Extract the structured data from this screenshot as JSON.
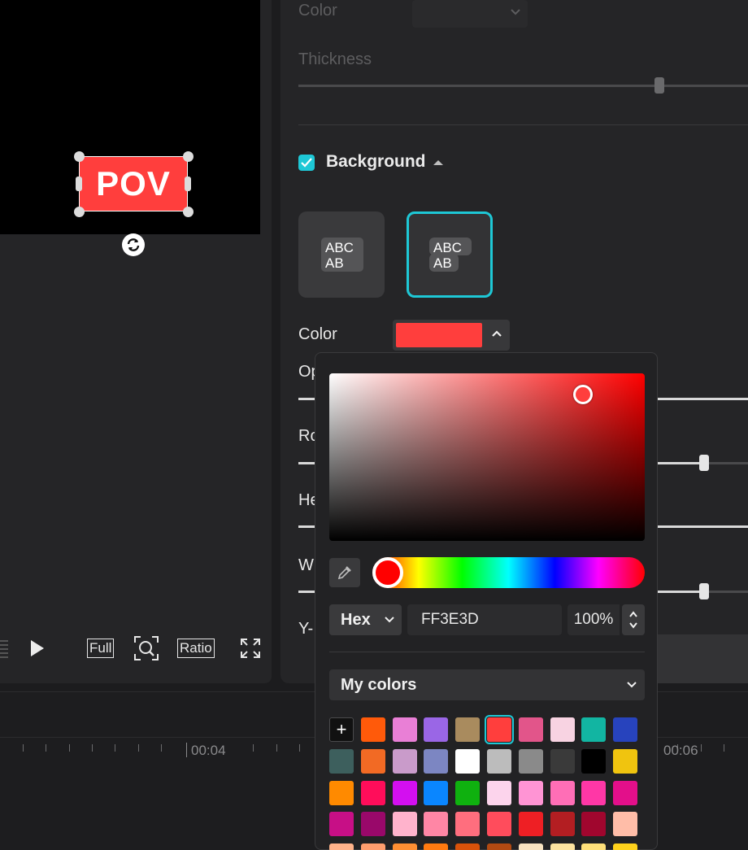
{
  "player": {
    "text_overlay": "POV",
    "buttons": {
      "full": "Full",
      "ratio": "Ratio"
    }
  },
  "props": {
    "border_color_label": "Color",
    "thickness_label": "Thickness",
    "background_label": "Background",
    "background_checked": true,
    "style_option_text": "ABC AB",
    "style_cards": [
      {
        "line1": "ABC",
        "line2": "AB",
        "selected": false
      },
      {
        "line1": "ABC",
        "line2": "AB",
        "selected": true
      }
    ],
    "bg_color_label": "Color",
    "bg_color_value": "#FF3E3D",
    "partial_labels": [
      "Op",
      "Ro",
      "He",
      "W",
      "Y-"
    ]
  },
  "picker": {
    "mode": "Hex",
    "hex_value": "FF3E3D",
    "opacity": "100%",
    "palette_label": "My colors",
    "add_label": "+",
    "swatches": [
      [
        "#ff5a0a",
        "#e97fd6",
        "#9a66e6",
        "#a98b5e",
        "#ff3e3d",
        "#e2558a",
        "#f8d3e2",
        "#12b5a2",
        "#2743bd"
      ],
      [
        "#3d5f5d",
        "#f26a24",
        "#c99bca",
        "#7c86c2",
        "#ffffff",
        "#bcbcbc",
        "#8a8a8a",
        "#3a3a3a",
        "#000000",
        "#f0c40f"
      ],
      [
        "#ff8a00",
        "#ff0d5a",
        "#d30ff0",
        "#0a86ff",
        "#0fb10f",
        "#fcd4ec",
        "#ff94d4",
        "#ff6eb6",
        "#ff37a6",
        "#e30f8a"
      ],
      [
        "#c70f86",
        "#99086a",
        "#ffb3cc",
        "#ff86a5",
        "#ff6e7e",
        "#ff4c5c",
        "#ee1f24",
        "#b31e22",
        "#a0062e",
        "#ffbda8"
      ]
    ],
    "selected_swatch": "#ff3e3d"
  },
  "timeline": {
    "time_1": "00:04",
    "time_2": "00:06"
  }
}
